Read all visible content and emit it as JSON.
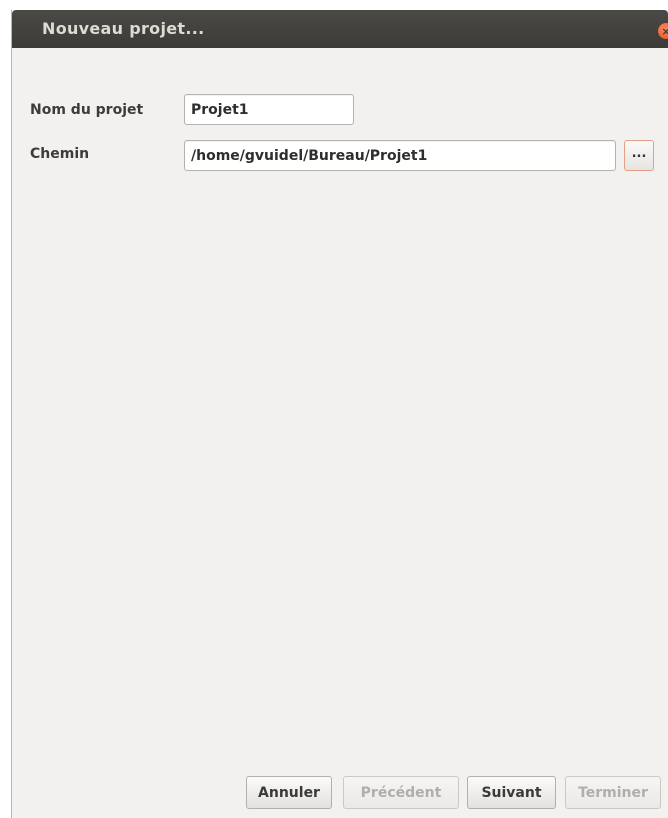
{
  "window": {
    "title": "Nouveau projet...",
    "close_glyph": "×"
  },
  "form": {
    "name_label": "Nom du projet",
    "name_value": "Projet1",
    "path_label": "Chemin",
    "path_value": "/home/gvuidel/Bureau/Projet1",
    "browse_label": "..."
  },
  "buttons": {
    "cancel": "Annuler",
    "previous": "Précédent",
    "next": "Suivant",
    "finish": "Terminer"
  },
  "state": {
    "previous_enabled": false,
    "finish_enabled": false
  },
  "colors": {
    "titlebar": "#3c3b37",
    "title_text": "#dfdbd2",
    "close_accent": "#e5521f",
    "dialog_bg": "#f2f1f0"
  }
}
